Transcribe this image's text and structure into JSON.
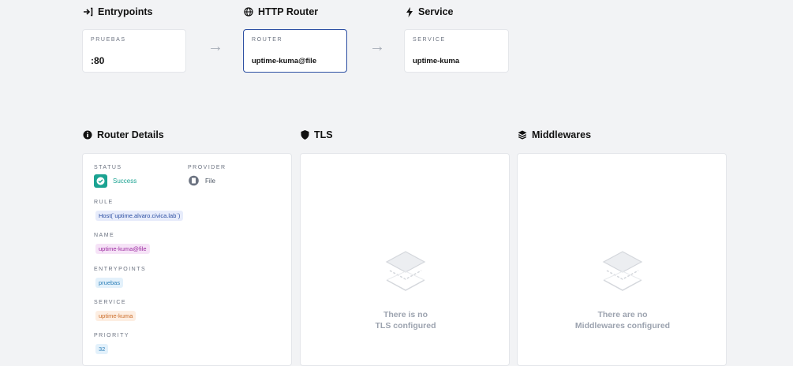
{
  "flow": {
    "entrypoints": {
      "title": "Entrypoints",
      "kicker": "PRUEBAS",
      "value": ":80"
    },
    "router": {
      "title": "HTTP Router",
      "kicker": "ROUTER",
      "value": "uptime-kuma@file"
    },
    "service": {
      "title": "Service",
      "kicker": "SERVICE",
      "value": "uptime-kuma"
    }
  },
  "details": {
    "title": "Router Details",
    "status_label": "STATUS",
    "status_value": "Success",
    "provider_label": "PROVIDER",
    "provider_value": "File",
    "rule_label": "RULE",
    "rule_value": "Host(`uptime.alvaro.civica.lab`)",
    "name_label": "NAME",
    "name_value": "uptime-kuma@file",
    "entrypoints_label": "ENTRYPOINTS",
    "entrypoints_value": "pruebas",
    "service_label": "SERVICE",
    "service_value": "uptime-kuma",
    "priority_label": "PRIORITY",
    "priority_value": "32"
  },
  "tls": {
    "title": "TLS",
    "empty_line1": "There is no",
    "empty_line2": "TLS configured"
  },
  "middlewares": {
    "title": "Middlewares",
    "empty_line1": "There are no",
    "empty_line2": "Middlewares configured"
  },
  "colors": {
    "active_border": "#2b4ea2",
    "success": "#1ba392",
    "background": "#f2f3f5"
  },
  "icons": {
    "entrypoints": "arrow-into-bracket-icon",
    "router": "globe-icon",
    "service": "lightning-icon",
    "details": "info-icon",
    "tls": "shield-icon",
    "middlewares": "layers-icon"
  }
}
